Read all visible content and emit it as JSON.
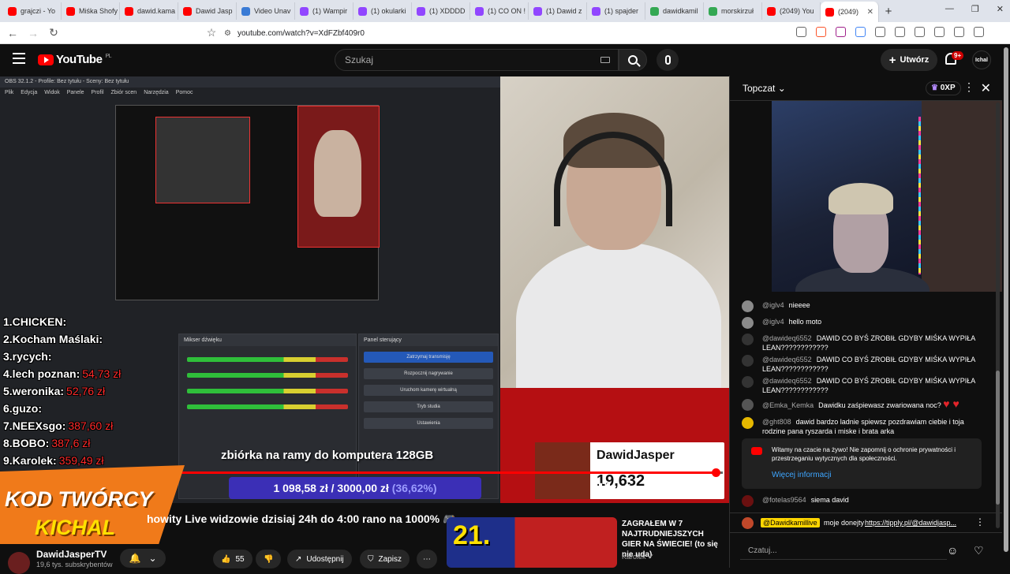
{
  "browser": {
    "tabs": [
      {
        "label": "grajczi - Yo",
        "color": "#ff0000"
      },
      {
        "label": "Miśka Shofy",
        "color": "#ff0000"
      },
      {
        "label": "dawid.kama",
        "color": "#ff0000"
      },
      {
        "label": "Dawid Jasp",
        "color": "#ff0000"
      },
      {
        "label": "Video Unav",
        "color": "#3a7bd5"
      },
      {
        "label": "(1) Wampir",
        "color": "#9146ff"
      },
      {
        "label": "(1) okularki",
        "color": "#9146ff"
      },
      {
        "label": "(1) XDDDD",
        "color": "#9146ff"
      },
      {
        "label": "(1) CO ON !",
        "color": "#9146ff"
      },
      {
        "label": "(1) Dawid z",
        "color": "#9146ff"
      },
      {
        "label": "(1) spajder",
        "color": "#9146ff"
      },
      {
        "label": "dawidkamil",
        "color": "#34a853"
      },
      {
        "label": "morskirzuł",
        "color": "#34a853"
      },
      {
        "label": "(2049) You",
        "color": "#ff0000"
      },
      {
        "label": "(2049)",
        "color": "#ff0000",
        "active": true
      }
    ],
    "url": "youtube.com/watch?v=XdFZbf409r0"
  },
  "header": {
    "logo": "YouTube",
    "region": "PL",
    "search_placeholder": "Szukaj",
    "create_label": "Utwórz",
    "notif_badge": "9+",
    "avatar_text": "Ichal"
  },
  "video": {
    "obs_title": "OBS 32.1.2 - Profile: Bez tytułu - Sceny: Bez tytułu",
    "obs_menu": [
      "Plik",
      "Edycja",
      "Widok",
      "Panele",
      "Profil",
      "Zbiór scen",
      "Narzędzia",
      "Pomoc"
    ],
    "obs_mixer_title": "Mikser dźwięku",
    "obs_controls_title": "Panel sterujący",
    "obs_buttons": [
      "Zatrzymaj transmisję",
      "Rozpocznij nagrywanie",
      "Uruchom kamerę wirtualną",
      "Tryb studia",
      "Ustawienia"
    ],
    "ranking": [
      {
        "label": "1.CHICKEN:",
        "amount": ""
      },
      {
        "label": "2.Kocham Maślaki:",
        "amount": ""
      },
      {
        "label": "3.rycych:",
        "amount": ""
      },
      {
        "label": "4.lech poznan:",
        "amount": "54,73 zł"
      },
      {
        "label": "5.weronika:",
        "amount": "52,76 zł"
      },
      {
        "label": "6.guzo:",
        "amount": ""
      },
      {
        "label": "7.NEEXsgo:",
        "amount": "387,60 zł"
      },
      {
        "label": "8.BOBO:",
        "amount": "387,6 zł"
      },
      {
        "label": "9.Karolek:",
        "amount": "359,49 zł"
      }
    ],
    "goal_title": "zbiórka na ramy do komputera 128GB",
    "goal_amount": "1 098,58 zł / 3000,00 zł",
    "goal_percent": "(36,62%)",
    "tip_name": "DawidJasper",
    "tip_count": "19,632",
    "progress_fraction": 0.99,
    "kod_line1": "KOD TWÓRCY",
    "kod_line2": "KICHAL"
  },
  "below": {
    "title": "howity Live widzowie dzisiaj 24h do 4:00 rano na 1000%",
    "channel": "DawidJasperTV",
    "subs": "19,6 tys. subskrybentów",
    "likes": "55",
    "share": "Udostępnij",
    "save": "Zapisz",
    "rec_title": "ZAGRAŁEM W 7 NAJTRUDNIEJSZYCH GIER NA ŚWIECIE! (to się nie uda)",
    "rec_channel": "Karolek",
    "rec_badge": "21."
  },
  "chat": {
    "mode": "Topczat",
    "xp": "0XP",
    "messages": [
      {
        "author": "@iglv4",
        "text": "nieeee",
        "color": "#8a8a8a"
      },
      {
        "author": "@iglv4",
        "text": "hello moto",
        "color": "#8a8a8a"
      },
      {
        "author": "@dawideq6552",
        "text": "DAWID CO BYŚ ZROBIŁ GDYBY MIŚKA WYPIŁA LEAN????????????",
        "color": "#333333"
      },
      {
        "author": "@dawideq6552",
        "text": "DAWID CO BYŚ ZROBIŁ GDYBY MIŚKA WYPIŁA LEAN????????????",
        "color": "#333333"
      },
      {
        "author": "@dawideq6552",
        "text": "DAWID CO BYŚ ZROBIŁ GDYBY MIŚKA WYPIŁA LEAN????????????",
        "color": "#333333"
      },
      {
        "author": "@Emka_Kemka",
        "text": "Dawidku zaśpiewasz zwariowana noc?",
        "color": "#555555",
        "hearts": "♥ ♥"
      },
      {
        "author": "@ght808",
        "text": "dawid bardzo ladnie spiewsz pozdrawiam ciebie i toja rodzine pana ryszarda i miske i brata arka",
        "color": "#e6b800"
      }
    ],
    "notice": "Witamy na czacie na żywo! Nie zapomnij o ochronie prywatności i przestrzeganiu wytycznych dla społeczności.",
    "notice_link": "Więcej informacji",
    "last_msg": {
      "author": "@fotelas9564",
      "text": "siema david"
    },
    "pinned": {
      "author": "@Dawidkamillive",
      "text": "moje donejty",
      "link": "https://tipply.pl/@dawidjasp..."
    },
    "input_placeholder": "Czatuj..."
  }
}
